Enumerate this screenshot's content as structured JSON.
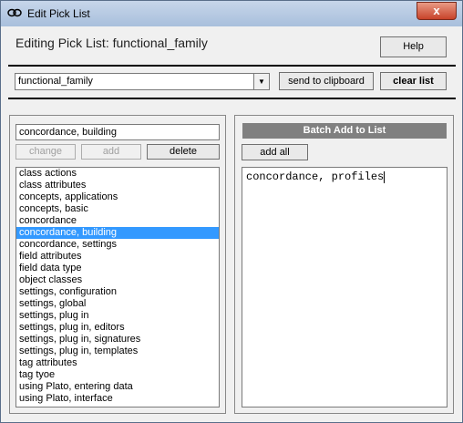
{
  "window": {
    "title": "Edit Pick List",
    "close_glyph": "x"
  },
  "header": {
    "heading": "Editing Pick List: functional_family",
    "help_label": "Help"
  },
  "toolbar": {
    "selected_list": "functional_family",
    "send_label": "send to clipboard",
    "clear_label": "clear list"
  },
  "left": {
    "entry_value": "concordance, building",
    "change_label": "change",
    "add_label": "add",
    "delete_label": "delete",
    "items": [
      "class actions",
      "class attributes",
      "concepts, applications",
      "concepts, basic",
      "concordance",
      "concordance, building",
      "concordance, settings",
      "field attributes",
      "field data type",
      "object classes",
      "settings, configuration",
      "settings, global",
      "settings, plug in",
      "settings, plug in, editors",
      "settings, plug in, signatures",
      "settings, plug in, templates",
      "tag attributes",
      "tag tyoe",
      "using Plato, entering data",
      "using Plato, interface"
    ],
    "selected_index": 5
  },
  "right": {
    "batch_title": "Batch Add to List",
    "add_all_label": "add all",
    "batch_text": "concordance, profiles"
  }
}
